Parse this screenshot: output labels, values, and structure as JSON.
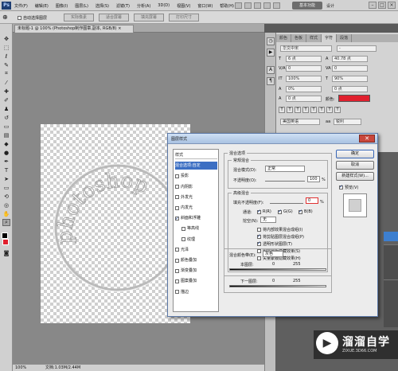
{
  "menubar": {
    "app_icon": "Ps",
    "menus": [
      "文件(F)",
      "编辑(E)",
      "图像(I)",
      "图层(L)",
      "选择(S)",
      "滤镜(T)",
      "分析(A)",
      "3D(D)",
      "视图(V)",
      "窗口(W)",
      "帮助(H)"
    ],
    "workspace": "基本功能",
    "workspace2": "设计"
  },
  "optbar": {
    "auto_select_label": "自动选择图层",
    "buttons": [
      "实际像素",
      "适合屏幕",
      "填充屏幕",
      "打印尺寸"
    ]
  },
  "document": {
    "tab_title": "未标题-1 @ 100% (Photoshop制作图章,副本, RGB/8) ×",
    "zoom": "100%",
    "status": "文档:1.03M/2.44M"
  },
  "character_panel": {
    "tabs": [
      "颜色",
      "色板",
      "样式",
      "字符",
      "段落"
    ],
    "font_family": "华文中宋",
    "font_style": "-",
    "size": "6 点",
    "leading": "40.78 点",
    "kerning": "0",
    "tracking": "0",
    "vertical_scale": "100%",
    "horizontal_scale": "90%",
    "baseline": "0%",
    "baseline_shift": "0 点",
    "color_label": "颜色:",
    "color": "#e0202e",
    "language": "美国英语",
    "anti_alias": "锐利"
  },
  "dialog": {
    "title": "图层样式",
    "style_list": [
      {
        "label": "样式",
        "checkbox": false,
        "checked": false,
        "type": "header"
      },
      {
        "label": "混合选项:自定",
        "checkbox": false,
        "checked": false,
        "type": "selected"
      },
      {
        "label": "投影",
        "checkbox": true,
        "checked": false,
        "type": "item"
      },
      {
        "label": "内阴影",
        "checkbox": true,
        "checked": false,
        "type": "item"
      },
      {
        "label": "外发光",
        "checkbox": true,
        "checked": false,
        "type": "item"
      },
      {
        "label": "内发光",
        "checkbox": true,
        "checked": false,
        "type": "item"
      },
      {
        "label": "斜面和浮雕",
        "checkbox": true,
        "checked": true,
        "type": "item"
      },
      {
        "label": "等高线",
        "checkbox": true,
        "checked": false,
        "type": "sub"
      },
      {
        "label": "纹理",
        "checkbox": true,
        "checked": false,
        "type": "sub"
      },
      {
        "label": "光泽",
        "checkbox": true,
        "checked": false,
        "type": "item"
      },
      {
        "label": "颜色叠加",
        "checkbox": true,
        "checked": false,
        "type": "item"
      },
      {
        "label": "渐变叠加",
        "checkbox": true,
        "checked": false,
        "type": "item"
      },
      {
        "label": "图案叠加",
        "checkbox": true,
        "checked": false,
        "type": "item"
      },
      {
        "label": "描边",
        "checkbox": true,
        "checked": false,
        "type": "item"
      }
    ],
    "blend_section_title": "混合选项",
    "general_blend_title": "常规混合",
    "blend_mode_label": "混合模式(D):",
    "blend_mode_value": "正常",
    "opacity_label": "不透明度(O):",
    "opacity_value": "100",
    "percent": "%",
    "advanced_blend_title": "高级混合",
    "fill_opacity_label": "填充不透明度(F):",
    "fill_opacity_value": "0",
    "channels_label": "通道:",
    "channel_r": "R(R)",
    "channel_g": "G(G)",
    "channel_b": "B(B)",
    "knockout_label": "挖空(N):",
    "knockout_value": "无",
    "options": [
      {
        "label": "将内部效果混合成组(I)",
        "checked": false
      },
      {
        "label": "将剪贴图层混合成组(P)",
        "checked": true
      },
      {
        "label": "透明形状图层(T)",
        "checked": true
      },
      {
        "label": "图层蒙版隐藏效果(S)",
        "checked": false
      },
      {
        "label": "矢量蒙版隐藏效果(H)",
        "checked": false
      }
    ],
    "blend_if_label": "混合颜色带(E):",
    "blend_if_value": "灰色",
    "this_layer_label": "本图层:",
    "underlying_layer_label": "下一图层:",
    "range_min": "0",
    "range_max": "255",
    "buttons": {
      "ok": "确定",
      "cancel": "取消",
      "new_style": "新建样式(W)...",
      "preview": "预览(V)"
    },
    "preview_checked": true
  },
  "stamp_text": "photoshop",
  "watermark": {
    "brand": "溜溜自学",
    "url": "ZIXUE.3D66.COM"
  }
}
